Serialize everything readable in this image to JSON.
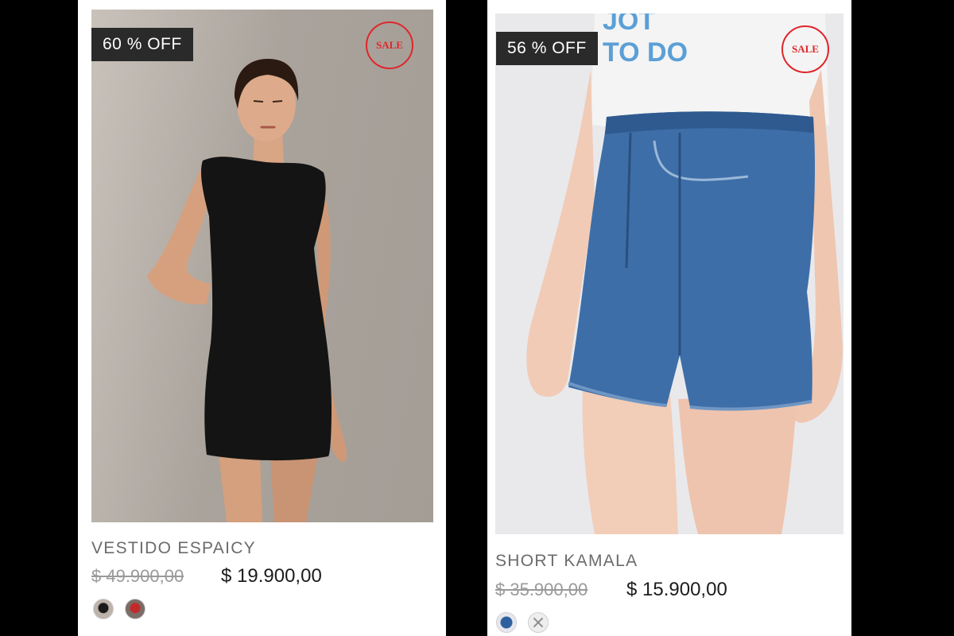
{
  "products": [
    {
      "discount": "60 % OFF",
      "sale_label": "SALE",
      "name": "VESTIDO ESPAICY",
      "old_price": "$ 49.900,00",
      "new_price": "$ 19.900,00",
      "swatches": [
        "black-dress-swatch-icon",
        "red-dress-swatch-icon"
      ]
    },
    {
      "discount": "56 % OFF",
      "sale_label": "SALE",
      "name": "SHORT KAMALA",
      "old_price": "$ 35.900,00",
      "new_price": "$ 15.900,00",
      "swatches": [
        "denim-swatch-icon",
        "unavailable-swatch-icon"
      ]
    }
  ],
  "colors": {
    "sale_red": "#e0262b",
    "badge_bg": "#2a2a2a",
    "background": "#000000"
  }
}
